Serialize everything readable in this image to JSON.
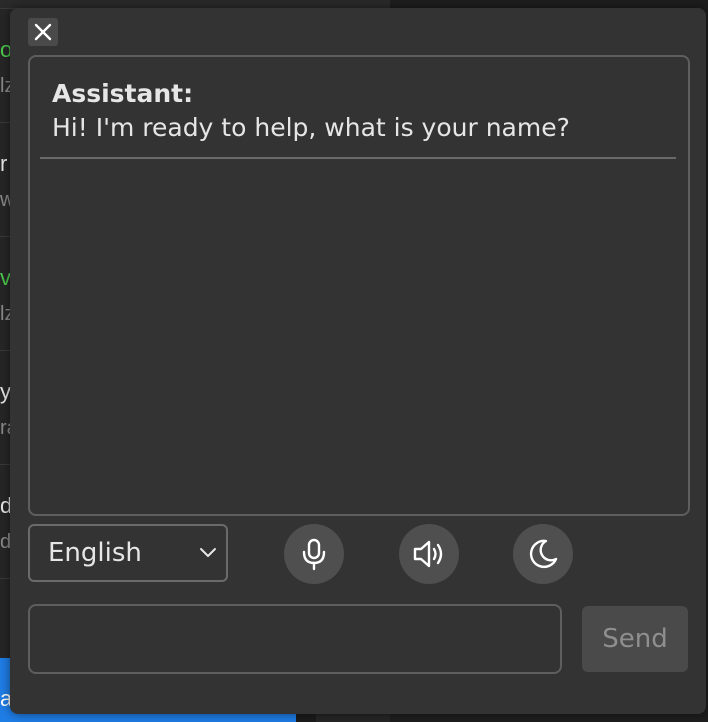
{
  "background_app": {
    "rows": [
      {
        "line1": "o",
        "line2": "lz",
        "line1_color": "#4cc94c"
      },
      {
        "line1": "r",
        "line2": "w",
        "line1_color": "#e6e6e6"
      },
      {
        "line1": "v",
        "line2": "lz",
        "line1_color": "#4cc94c"
      },
      {
        "line1": "yl",
        "line2": "ra",
        "line1_color": "#e6e6e6"
      },
      {
        "line1": "d",
        "line2": "d",
        "line1_color": "#e6e6e6"
      }
    ],
    "bottom_text": "a"
  },
  "dialog": {
    "close_icon": "close-icon",
    "messages": [
      {
        "sender": "Assistant:",
        "text": "Hi! I'm ready to help, what is your name?"
      }
    ],
    "language": {
      "selected": "English",
      "icon": "chevron-down-icon"
    },
    "buttons": {
      "mic_icon": "microphone-icon",
      "speaker_icon": "speaker-icon",
      "theme_icon": "moon-icon"
    },
    "input": {
      "value": "",
      "placeholder": ""
    },
    "send_label": "Send"
  },
  "colors": {
    "dialog_bg": "#333333",
    "border": "#5e5e5e",
    "button_bg": "#4f4f4f",
    "text": "#e6e6e6",
    "accent_green": "#4cc94c",
    "accent_blue": "#1f7de6"
  }
}
